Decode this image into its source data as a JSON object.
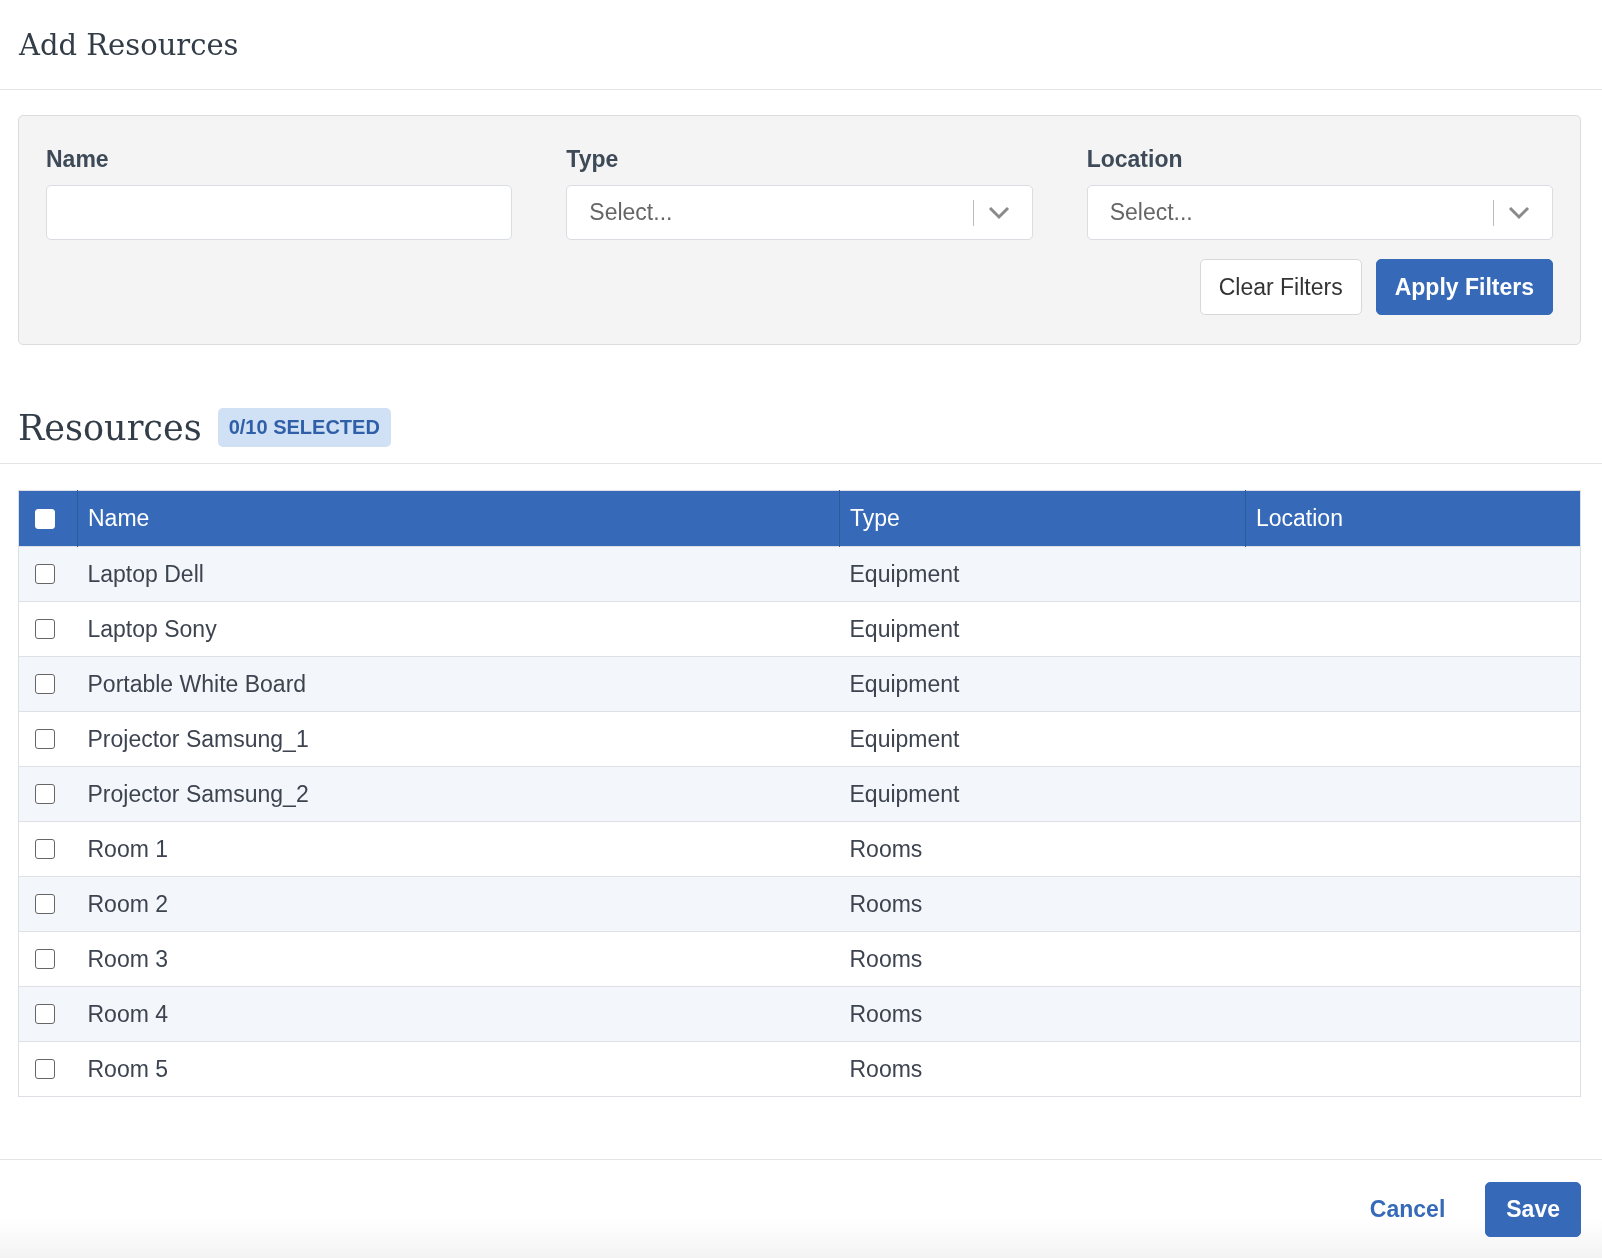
{
  "dialog": {
    "title": "Add Resources"
  },
  "filters": {
    "fields": [
      {
        "kind": "text",
        "label": "Name"
      },
      {
        "kind": "select",
        "label": "Type",
        "placeholder": "Select..."
      },
      {
        "kind": "select",
        "label": "Location",
        "placeholder": "Select..."
      }
    ],
    "buttons": [
      {
        "label": "Clear Filters",
        "kind": "secondary"
      },
      {
        "label": "Apply Filters",
        "kind": "primary"
      }
    ]
  },
  "resources": {
    "title": "Resources",
    "badge": "0/10 SELECTED"
  },
  "table": {
    "select_all": {
      "checked": false
    },
    "columns": [
      "Name",
      "Type",
      "Location"
    ],
    "rows": [
      {
        "checked": false,
        "cells": [
          "Laptop Dell",
          "Equipment"
        ]
      },
      {
        "checked": false,
        "cells": [
          "Laptop Sony",
          "Equipment"
        ]
      },
      {
        "checked": false,
        "cells": [
          "Portable White Board",
          "Equipment"
        ]
      },
      {
        "checked": false,
        "cells": [
          "Projector Samsung_1",
          "Equipment"
        ]
      },
      {
        "checked": false,
        "cells": [
          "Projector Samsung_2",
          "Equipment"
        ]
      },
      {
        "checked": false,
        "cells": [
          "Room 1",
          "Rooms"
        ]
      },
      {
        "checked": false,
        "cells": [
          "Room 2",
          "Rooms"
        ]
      },
      {
        "checked": false,
        "cells": [
          "Room 3",
          "Rooms"
        ]
      },
      {
        "checked": false,
        "cells": [
          "Room 4",
          "Rooms"
        ]
      },
      {
        "checked": false,
        "cells": [
          "Room 5",
          "Rooms"
        ]
      }
    ]
  },
  "footer": {
    "buttons": [
      {
        "label": "Cancel",
        "kind": "link"
      },
      {
        "label": "Save",
        "kind": "primary"
      }
    ]
  }
}
